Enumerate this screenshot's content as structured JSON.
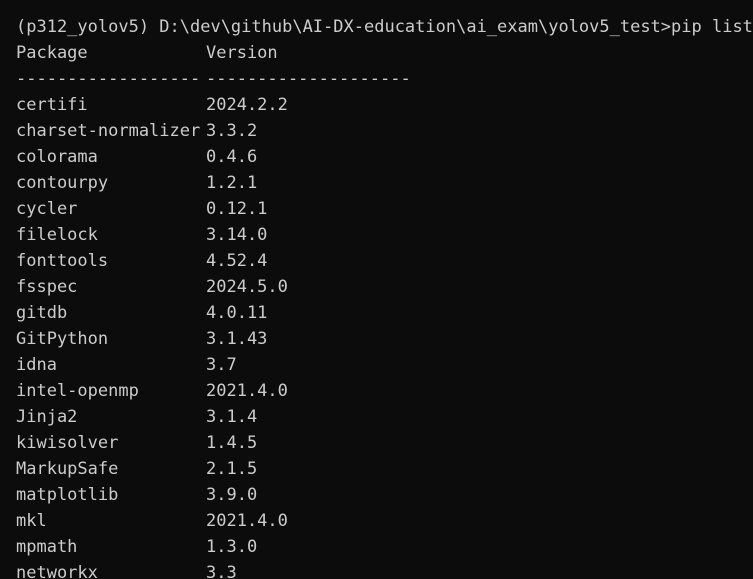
{
  "terminal": {
    "prompt": "(p312_yolov5) D:\\dev\\github\\AI-DX-education\\ai_exam\\yolov5_test>pip list",
    "header": {
      "package": "Package",
      "version": "Version"
    },
    "separator": {
      "package": "------------------",
      "version": "--------------------"
    },
    "rows": [
      {
        "package": "certifi",
        "version": "2024.2.2"
      },
      {
        "package": "charset-normalizer",
        "version": "3.3.2"
      },
      {
        "package": "colorama",
        "version": "0.4.6"
      },
      {
        "package": "contourpy",
        "version": "1.2.1"
      },
      {
        "package": "cycler",
        "version": "0.12.1"
      },
      {
        "package": "filelock",
        "version": "3.14.0"
      },
      {
        "package": "fonttools",
        "version": "4.52.4"
      },
      {
        "package": "fsspec",
        "version": "2024.5.0"
      },
      {
        "package": "gitdb",
        "version": "4.0.11"
      },
      {
        "package": "GitPython",
        "version": "3.1.43"
      },
      {
        "package": "idna",
        "version": "3.7"
      },
      {
        "package": "intel-openmp",
        "version": "2021.4.0"
      },
      {
        "package": "Jinja2",
        "version": "3.1.4"
      },
      {
        "package": "kiwisolver",
        "version": "1.4.5"
      },
      {
        "package": "MarkupSafe",
        "version": "2.1.5"
      },
      {
        "package": "matplotlib",
        "version": "3.9.0"
      },
      {
        "package": "mkl",
        "version": "2021.4.0"
      },
      {
        "package": "mpmath",
        "version": "1.3.0"
      },
      {
        "package": "networkx",
        "version": "3.3"
      }
    ]
  }
}
